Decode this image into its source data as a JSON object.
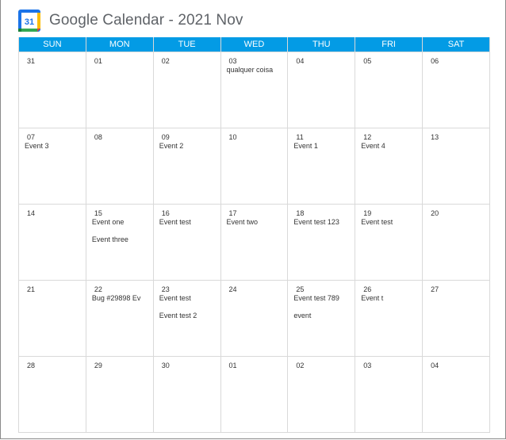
{
  "header": {
    "title": "Google Calendar - 2021 Nov",
    "logo_day": "31"
  },
  "colors": {
    "header_bg": "#039be5",
    "header_text": "#ffffff"
  },
  "weekdays": [
    "SUN",
    "MON",
    "TUE",
    "WED",
    "THU",
    "FRI",
    "SAT"
  ],
  "weeks": [
    [
      {
        "day": "31",
        "events": []
      },
      {
        "day": "01",
        "events": []
      },
      {
        "day": "02",
        "events": []
      },
      {
        "day": "03",
        "events": [
          "qualquer coisa"
        ]
      },
      {
        "day": "04",
        "events": []
      },
      {
        "day": "05",
        "events": []
      },
      {
        "day": "06",
        "events": []
      }
    ],
    [
      {
        "day": "07",
        "events": [
          "Event 3"
        ]
      },
      {
        "day": "08",
        "events": []
      },
      {
        "day": "09",
        "events": [
          "Event 2"
        ]
      },
      {
        "day": "10",
        "events": []
      },
      {
        "day": "11",
        "events": [
          "Event 1"
        ]
      },
      {
        "day": "12",
        "events": [
          "Event 4"
        ]
      },
      {
        "day": "13",
        "events": []
      }
    ],
    [
      {
        "day": "14",
        "events": []
      },
      {
        "day": "15",
        "events": [
          "Event one",
          "Event three"
        ]
      },
      {
        "day": "16",
        "events": [
          "Event test"
        ]
      },
      {
        "day": "17",
        "events": [
          "Event two"
        ]
      },
      {
        "day": "18",
        "events": [
          "Event test 123"
        ]
      },
      {
        "day": "19",
        "events": [
          "Event test"
        ]
      },
      {
        "day": "20",
        "events": []
      }
    ],
    [
      {
        "day": "21",
        "events": []
      },
      {
        "day": "22",
        "events": [
          "Bug #29898 Ev"
        ]
      },
      {
        "day": "23",
        "events": [
          "Event test",
          "Event test 2"
        ]
      },
      {
        "day": "24",
        "events": []
      },
      {
        "day": "25",
        "events": [
          "Event test 789",
          "event"
        ]
      },
      {
        "day": "26",
        "events": [
          "Event t"
        ]
      },
      {
        "day": "27",
        "events": []
      }
    ],
    [
      {
        "day": "28",
        "events": []
      },
      {
        "day": "29",
        "events": []
      },
      {
        "day": "30",
        "events": []
      },
      {
        "day": "01",
        "events": []
      },
      {
        "day": "02",
        "events": []
      },
      {
        "day": "03",
        "events": []
      },
      {
        "day": "04",
        "events": []
      }
    ]
  ]
}
